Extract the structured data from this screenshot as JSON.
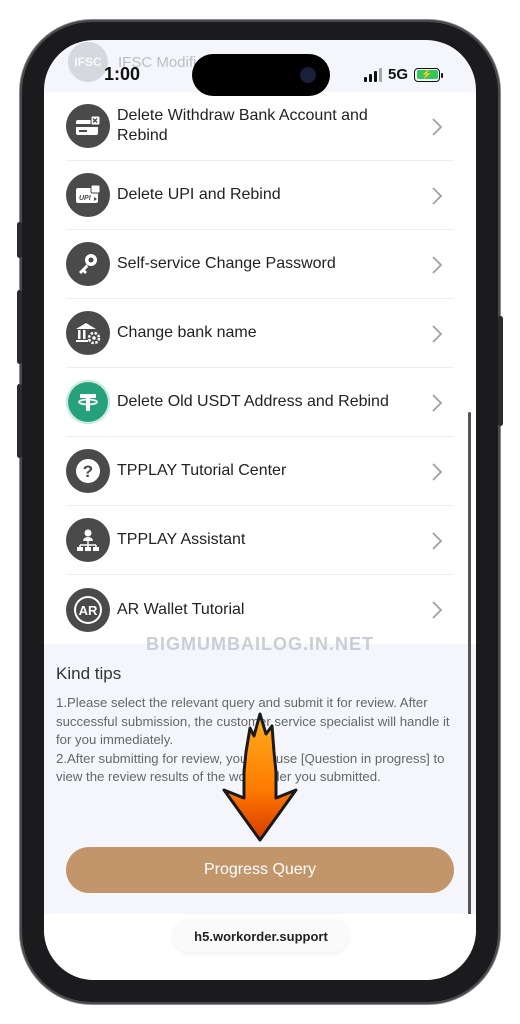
{
  "status_bar": {
    "time": "1:00",
    "network": "5G",
    "behind_item": {
      "logo_text": "IFSC",
      "label": "IFSC Modification"
    }
  },
  "menu_items": [
    {
      "label": "Delete Withdraw Bank Account and Rebind",
      "icon": "bank-card-icon"
    },
    {
      "label": "Delete UPI and Rebind",
      "icon": "upi-card-icon"
    },
    {
      "label": "Self-service Change Password",
      "icon": "key-icon"
    },
    {
      "label": "Change bank name",
      "icon": "bank-gear-icon"
    },
    {
      "label": "Delete Old USDT Address and Rebind",
      "icon": "tether-icon"
    },
    {
      "label": "TPPLAY Tutorial Center",
      "icon": "question-icon"
    },
    {
      "label": "TPPLAY Assistant",
      "icon": "assistant-network-icon"
    },
    {
      "label": "AR Wallet Tutorial",
      "icon": "ar-wallet-icon"
    }
  ],
  "watermark": "BIGMUMBAILOG.IN.NET",
  "kind_tips": {
    "title": "Kind tips",
    "tip1": "1.Please select the relevant query and submit it for review. After successful submission, the customer service specialist will handle it for you immediately.",
    "tip2": "2.After submitting for review, you can use [Question in progress] to view the review results of the work order you submitted."
  },
  "progress_button": "Progress Query",
  "url": "h5.workorder.support",
  "colors": {
    "button": "#c2956a",
    "tether": "#26a17b",
    "icon_bg": "#4a4a4a"
  }
}
